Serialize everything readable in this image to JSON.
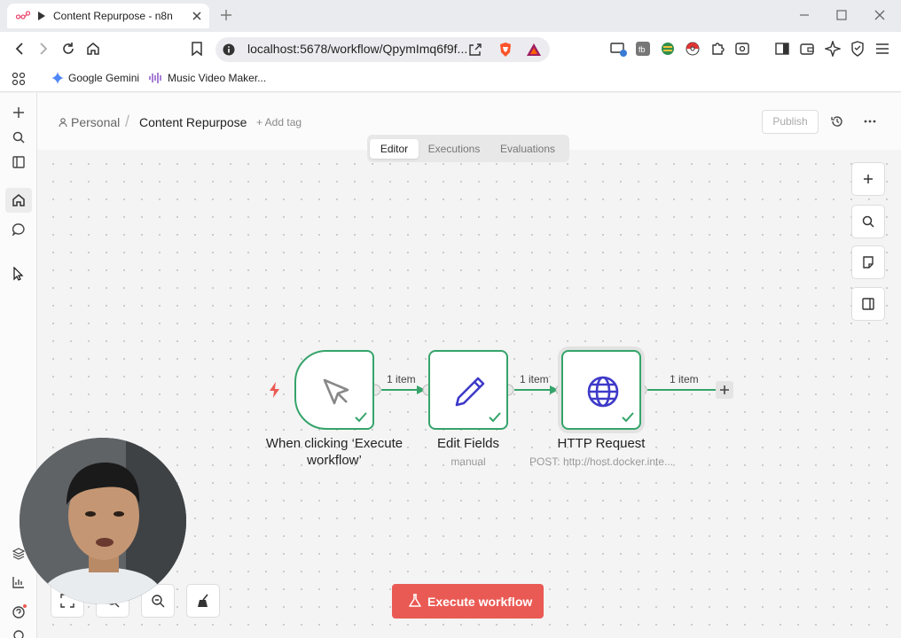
{
  "browser": {
    "tab_title": "Content Repurpose - n8n",
    "url": "localhost:5678/workflow/QpymImq6f9f...",
    "bookmarks": [
      {
        "label": "Google Gemini",
        "icon": "gemini-icon"
      },
      {
        "label": "Music Video Maker...",
        "icon": "soundwave-icon"
      }
    ]
  },
  "header": {
    "breadcrumb_home": "Personal",
    "breadcrumb_sep": "/",
    "workflow_name": "Content Repurpose",
    "add_tag": "+ Add tag",
    "publish_label": "Publish"
  },
  "view_tabs": [
    "Editor",
    "Executions",
    "Evaluations"
  ],
  "active_view_tab": "Editor",
  "nodes": [
    {
      "name": "When clicking ‘Execute workflow’",
      "subtitle": "",
      "icon": "cursor-icon",
      "status": "success"
    },
    {
      "name": "Edit Fields",
      "subtitle": "manual",
      "icon": "pencil-icon",
      "status": "success"
    },
    {
      "name": "HTTP Request",
      "subtitle": "POST: http://host.docker.inte...",
      "icon": "globe-icon",
      "status": "success"
    }
  ],
  "connections": [
    {
      "label": "1 item"
    },
    {
      "label": "1 item"
    },
    {
      "label": "1 item"
    }
  ],
  "execute_button": "Execute workflow",
  "colors": {
    "success": "#35a46a",
    "execute": "#ea5a54",
    "node_icon": "#3e3ac9",
    "trigger_bolt": "#ea5a54"
  }
}
